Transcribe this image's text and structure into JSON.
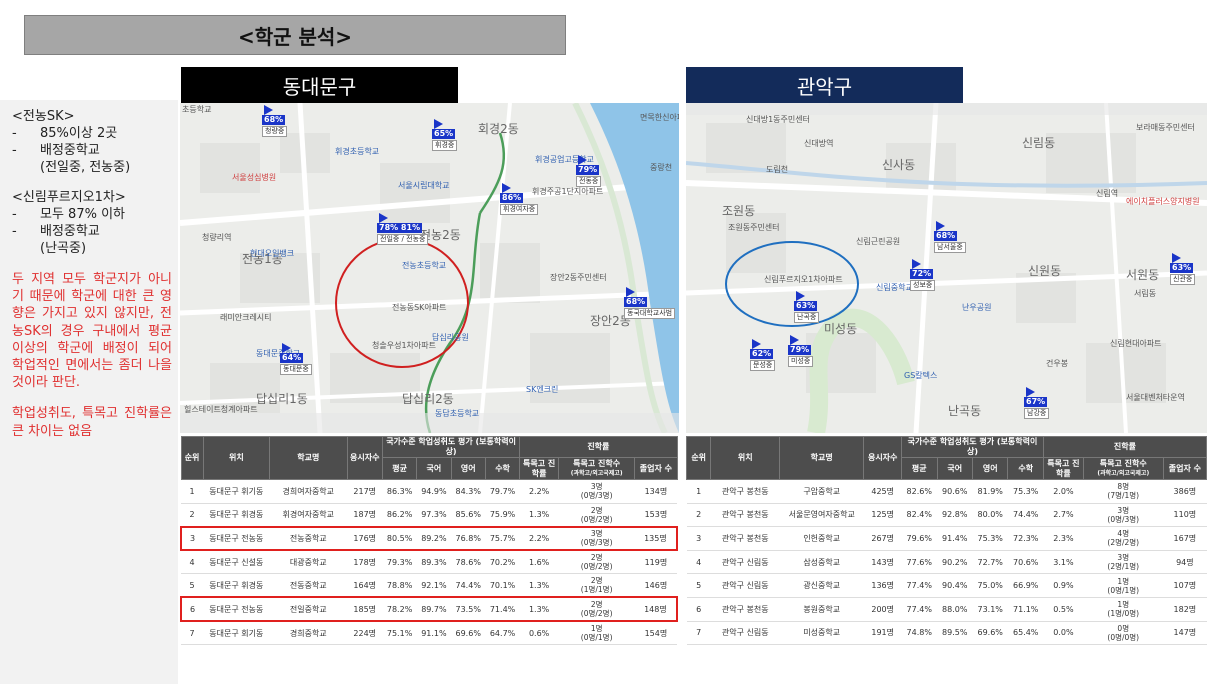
{
  "page_title": "<학군 분석>",
  "regions": {
    "left": "동대문구",
    "right": "관악구"
  },
  "sidebar": {
    "sk_heading": "<전농SK>",
    "sk_items": [
      {
        "dash": "-",
        "text": "85%이상 2곳"
      },
      {
        "dash": "-",
        "text": "배정중학교"
      }
    ],
    "sk_cont": "(전일중, 전농중)",
    "sr_heading": "<신림푸르지오1차>",
    "sr_items": [
      {
        "dash": "-",
        "text": "모두 87% 이하"
      },
      {
        "dash": "-",
        "text": "배정중학교"
      }
    ],
    "sr_cont": "(난곡중)",
    "conclusion": "두 지역 모두 학군지가 아니기 때문에 학군에 대한 큰 영향은 가지고 있지 않지만, 전농SK의 경우 구내에서 평균 이상의 학군에 배정이 되어 학업적인 면에서는 좀더 나을 것이라 판단.",
    "note": "학업성취도, 특목고 진학률은 큰 차이는 없음"
  },
  "map_left": {
    "labels": {
      "l1": "초등학교",
      "l2": "회경2동",
      "l3": "휘경초등학교",
      "l4": "휘경공업고등학교",
      "l5": "휘경주공1단지아파트",
      "l6": "서울시립대학교",
      "l7": "전농2동",
      "l8": "전농초등학교",
      "l9": "장안2동주민센터",
      "l10": "전농동SK아파트",
      "l11": "장안2동",
      "l12": "답십리1동",
      "l13": "답십리2동",
      "l14": "동답초등학교",
      "l15": "래미안크레시티",
      "l16": "청솔우성1차아파트",
      "l17": "SK엔크린",
      "l18": "전농1동",
      "l19": "동대문중학교",
      "l20": "현대오일뱅크",
      "l21": "서울성심병원",
      "l22": "청량리역",
      "l23": "동국대학교사범대",
      "l24": "답십리공원",
      "l25": "힐스테이트청계아파트",
      "l26": "중랑천",
      "l27": "면목한신아파트"
    },
    "pins": [
      {
        "pct": "68%",
        "lbl": "청량중"
      },
      {
        "pct": "65%",
        "lbl": "휘경중"
      },
      {
        "pct": "79%",
        "lbl": "전동중"
      },
      {
        "pct": "86%",
        "lbl": "휘경여자중"
      },
      {
        "pct": "78% 81%",
        "lbl": "전일중 / 전농중"
      },
      {
        "pct": "68%",
        "lbl": "동국대학교사범"
      },
      {
        "pct": "64%",
        "lbl": "동대문중"
      }
    ]
  },
  "map_right": {
    "labels": {
      "r1": "신대방1동주민센터",
      "r2": "신대방역",
      "r3": "보라매동주민센터",
      "r4": "신사동",
      "r5": "신림동",
      "r6": "신림역",
      "r7": "에이치플러스양지병원",
      "r8": "조원동",
      "r9": "조원동주민센터",
      "r10": "신림근린공원",
      "r11": "신림푸르지오1차아파트",
      "r12": "서원동",
      "r13": "신원동",
      "r14": "미성동",
      "r15": "난곡동",
      "r16": "GS칼텍스",
      "r17": "건우봉",
      "r18": "신림현대아파트",
      "r19": "서울대벤처타운역",
      "r20": "도림천",
      "r21": "신림중학교",
      "r22": "난우공원",
      "r23": "서림동"
    },
    "pins": [
      {
        "pct": "68%",
        "lbl": "남서울중"
      },
      {
        "pct": "72%",
        "lbl": "성보중"
      },
      {
        "pct": "63%",
        "lbl": "난곡중"
      },
      {
        "pct": "79%",
        "lbl": "미성중"
      },
      {
        "pct": "62%",
        "lbl": "문성중"
      },
      {
        "pct": "67%",
        "lbl": "남강중"
      },
      {
        "pct": "63%",
        "lbl": "신관중"
      }
    ]
  },
  "table": {
    "headers": {
      "rank": "순위",
      "location": "위치",
      "school": "학교명",
      "applicants": "응시자수",
      "national": "국가수준 학업성취도 평가 (보통학력이상)",
      "avg": "평균",
      "kor": "국어",
      "eng": "영어",
      "math": "수학",
      "progress": "진학률",
      "special_rate": "특목고 진학률",
      "special_count": "특목고 진학수",
      "special_sub": "(과학고/외고국제고)",
      "graduates": "졸업자 수"
    },
    "left_rows": [
      {
        "rank": "1",
        "loc": "동대문구 휘기동",
        "school": "경희여자중학교",
        "app": "217명",
        "avg": "86.3%",
        "kor": "94.9%",
        "eng": "84.3%",
        "math": "79.7%",
        "rate": "2.2%",
        "cnt": "3명",
        "cnt2": "(0명/3명)",
        "grad": "134명",
        "hl": false
      },
      {
        "rank": "2",
        "loc": "동대문구 휘경동",
        "school": "휘경여자중학교",
        "app": "187명",
        "avg": "86.2%",
        "kor": "97.3%",
        "eng": "85.6%",
        "math": "75.9%",
        "rate": "1.3%",
        "cnt": "2명",
        "cnt2": "(0명/2명)",
        "grad": "153명",
        "hl": false
      },
      {
        "rank": "3",
        "loc": "동대문구 전농동",
        "school": "전농중학교",
        "app": "176명",
        "avg": "80.5%",
        "kor": "89.2%",
        "eng": "76.8%",
        "math": "75.7%",
        "rate": "2.2%",
        "cnt": "3명",
        "cnt2": "(0명/3명)",
        "grad": "135명",
        "hl": true
      },
      {
        "rank": "4",
        "loc": "동대문구 신설동",
        "school": "대광중학교",
        "app": "178명",
        "avg": "79.3%",
        "kor": "89.3%",
        "eng": "78.6%",
        "math": "70.2%",
        "rate": "1.6%",
        "cnt": "2명",
        "cnt2": "(0명/2명)",
        "grad": "119명",
        "hl": false
      },
      {
        "rank": "5",
        "loc": "동대문구 휘경동",
        "school": "전동중학교",
        "app": "164명",
        "avg": "78.8%",
        "kor": "92.1%",
        "eng": "74.4%",
        "math": "70.1%",
        "rate": "1.3%",
        "cnt": "2명",
        "cnt2": "(1명/1명)",
        "grad": "146명",
        "hl": false
      },
      {
        "rank": "6",
        "loc": "동대문구 전농동",
        "school": "전일중학교",
        "app": "185명",
        "avg": "78.2%",
        "kor": "89.7%",
        "eng": "73.5%",
        "math": "71.4%",
        "rate": "1.3%",
        "cnt": "2명",
        "cnt2": "(0명/2명)",
        "grad": "148명",
        "hl": true
      },
      {
        "rank": "7",
        "loc": "동대문구 회기동",
        "school": "경희중학교",
        "app": "224명",
        "avg": "75.1%",
        "kor": "91.1%",
        "eng": "69.6%",
        "math": "64.7%",
        "rate": "0.6%",
        "cnt": "1명",
        "cnt2": "(0명/1명)",
        "grad": "154명",
        "hl": false
      }
    ],
    "right_rows": [
      {
        "rank": "1",
        "loc": "관악구 봉천동",
        "school": "구암중학교",
        "app": "425명",
        "avg": "82.6%",
        "kor": "90.6%",
        "eng": "81.9%",
        "math": "75.3%",
        "rate": "2.0%",
        "cnt": "8명",
        "cnt2": "(7명/1명)",
        "grad": "386명"
      },
      {
        "rank": "2",
        "loc": "관악구 봉천동",
        "school": "서울문영여자중학교",
        "app": "125명",
        "avg": "82.4%",
        "kor": "92.8%",
        "eng": "80.0%",
        "math": "74.4%",
        "rate": "2.7%",
        "cnt": "3명",
        "cnt2": "(0명/3명)",
        "grad": "110명"
      },
      {
        "rank": "3",
        "loc": "관악구 봉천동",
        "school": "인헌중학교",
        "app": "267명",
        "avg": "79.6%",
        "kor": "91.4%",
        "eng": "75.3%",
        "math": "72.3%",
        "rate": "2.3%",
        "cnt": "4명",
        "cnt2": "(2명/2명)",
        "grad": "167명"
      },
      {
        "rank": "4",
        "loc": "관악구 신림동",
        "school": "삼성중학교",
        "app": "143명",
        "avg": "77.6%",
        "kor": "90.2%",
        "eng": "72.7%",
        "math": "70.6%",
        "rate": "3.1%",
        "cnt": "3명",
        "cnt2": "(2명/1명)",
        "grad": "94명"
      },
      {
        "rank": "5",
        "loc": "관악구 신림동",
        "school": "광신중학교",
        "app": "136명",
        "avg": "77.4%",
        "kor": "90.4%",
        "eng": "75.0%",
        "math": "66.9%",
        "rate": "0.9%",
        "cnt": "1명",
        "cnt2": "(0명/1명)",
        "grad": "107명"
      },
      {
        "rank": "6",
        "loc": "관악구 봉천동",
        "school": "봉원중학교",
        "app": "200명",
        "avg": "77.4%",
        "kor": "88.0%",
        "eng": "73.1%",
        "math": "71.1%",
        "rate": "0.5%",
        "cnt": "1명",
        "cnt2": "(1명/0명)",
        "grad": "182명"
      },
      {
        "rank": "7",
        "loc": "관악구 신림동",
        "school": "미성중학교",
        "app": "191명",
        "avg": "74.8%",
        "kor": "89.5%",
        "eng": "69.6%",
        "math": "65.4%",
        "rate": "0.0%",
        "cnt": "0명",
        "cnt2": "(0명/0명)",
        "grad": "147명"
      }
    ]
  },
  "colors": {
    "title_bg": "#a6a6a6",
    "left_tab": "#000000",
    "right_tab": "#132b5a",
    "circle_left": "#d02020",
    "circle_right": "#1f6fc0",
    "highlight": "#e0201e",
    "conclusion_text": "#e03030"
  }
}
